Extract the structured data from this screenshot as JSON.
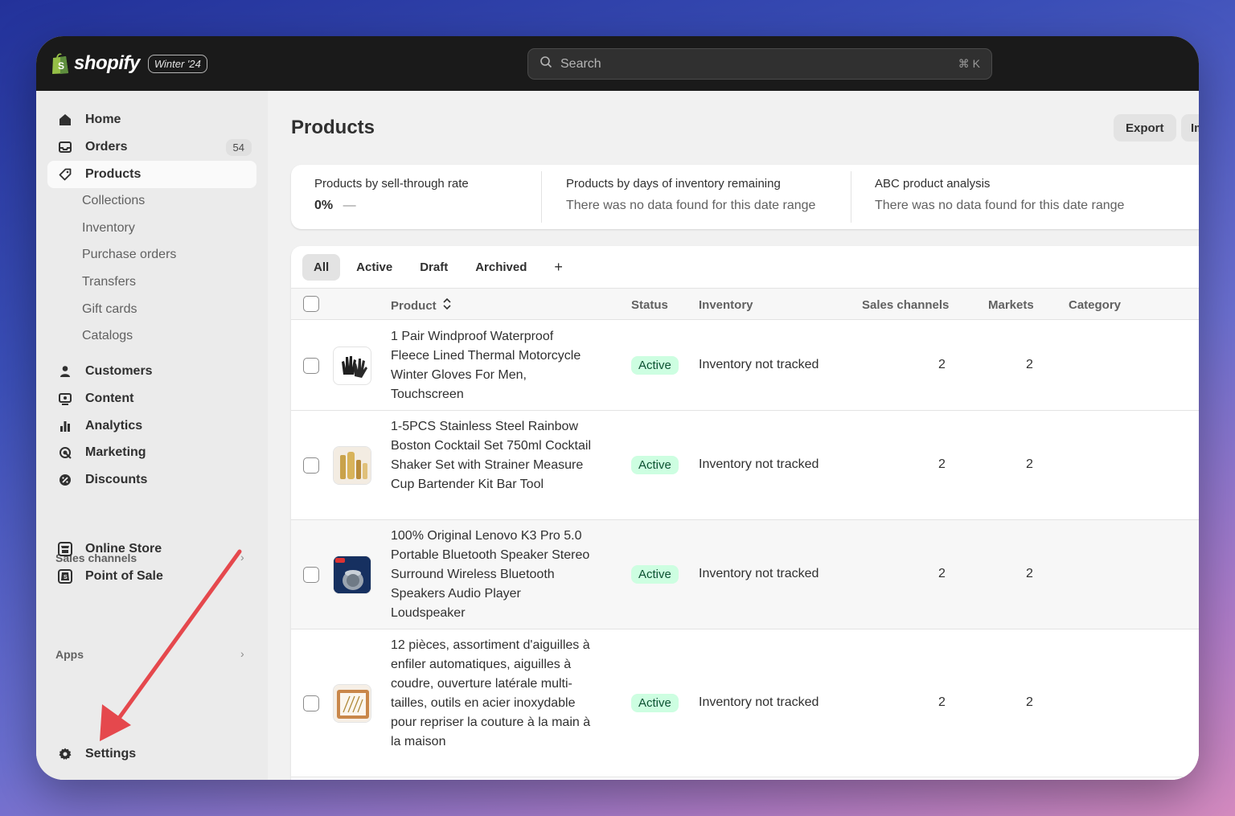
{
  "brand": {
    "name": "shopify",
    "edition": "Winter '24"
  },
  "search": {
    "placeholder": "Search",
    "shortcut": "⌘ K"
  },
  "sidebar": {
    "home": "Home",
    "orders": "Orders",
    "orders_count": "54",
    "products": "Products",
    "sub": [
      "Collections",
      "Inventory",
      "Purchase orders",
      "Transfers",
      "Gift cards",
      "Catalogs"
    ],
    "customers": "Customers",
    "content": "Content",
    "analytics": "Analytics",
    "marketing": "Marketing",
    "discounts": "Discounts",
    "sales_channels_label": "Sales channels",
    "online_store": "Online Store",
    "point_of_sale": "Point of Sale",
    "apps_label": "Apps",
    "settings": "Settings"
  },
  "page": {
    "title": "Products",
    "export_label": "Export",
    "import_label": "Im"
  },
  "metrics": [
    {
      "title": "Products by sell-through rate",
      "value": "0%",
      "trend": "—"
    },
    {
      "title": "Products by days of inventory remaining",
      "value": "There was no data found for this date range"
    },
    {
      "title": "ABC product analysis",
      "value": "There was no data found for this date range"
    }
  ],
  "tabs": [
    "All",
    "Active",
    "Draft",
    "Archived"
  ],
  "tab_add": "+",
  "columns": {
    "product": "Product",
    "status": "Status",
    "inventory": "Inventory",
    "sales_channels": "Sales channels",
    "markets": "Markets",
    "category": "Category"
  },
  "rows": [
    {
      "name": "1 Pair Windproof Waterproof Fleece Lined Thermal Motorcycle Winter Gloves For Men, Touchscreen",
      "status": "Active",
      "inventory": "Inventory not tracked",
      "sales_channels": "2",
      "markets": "2",
      "thumb": "gloves"
    },
    {
      "name": "1-5PCS Stainless Steel Rainbow Boston Cocktail Set 750ml Cocktail Shaker Set with Strainer Measure Cup Bartender Kit Bar Tool",
      "status": "Active",
      "inventory": "Inventory not tracked",
      "sales_channels": "2",
      "markets": "2",
      "thumb": "cocktail-set"
    },
    {
      "name": "100% Original Lenovo K3 Pro 5.0 Portable Bluetooth Speaker Stereo Surround Wireless Bluetooth Speakers Audio Player Loudspeaker",
      "status": "Active",
      "inventory": "Inventory not tracked",
      "sales_channels": "2",
      "markets": "2",
      "thumb": "speaker"
    },
    {
      "name": "12 pièces, assortiment d'aiguilles à enfiler automatiques, aiguilles à coudre, ouverture latérale multi-tailles, outils en acier inoxydable pour repriser la couture à la main à la maison",
      "status": "Active",
      "inventory": "Inventory not tracked",
      "sales_channels": "2",
      "markets": "2",
      "thumb": "needles"
    }
  ],
  "colors": {
    "topbar": "#1a1a1a",
    "status_bg": "#cdfee1",
    "status_text": "#0c5132",
    "annotation_arrow": "#e5484d"
  }
}
